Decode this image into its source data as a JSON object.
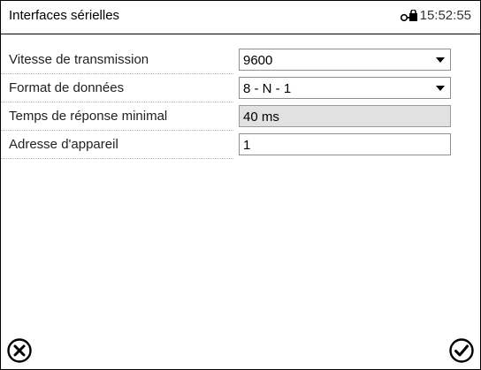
{
  "header": {
    "title": "Interfaces sérielles",
    "time": "15:52:55",
    "lock_icon": "key-lock-icon"
  },
  "settings": [
    {
      "label": "Vitesse de transmission",
      "value": "9600",
      "type": "dropdown"
    },
    {
      "label": "Format de données",
      "value": "8 - N - 1",
      "type": "dropdown"
    },
    {
      "label": "Temps de réponse minimal",
      "value": "40 ms",
      "type": "readonly"
    },
    {
      "label": "Adresse d'appareil",
      "value": "1",
      "type": "input"
    }
  ],
  "footer": {
    "cancel_icon": "cancel-circle-icon",
    "confirm_icon": "confirm-check-icon"
  }
}
